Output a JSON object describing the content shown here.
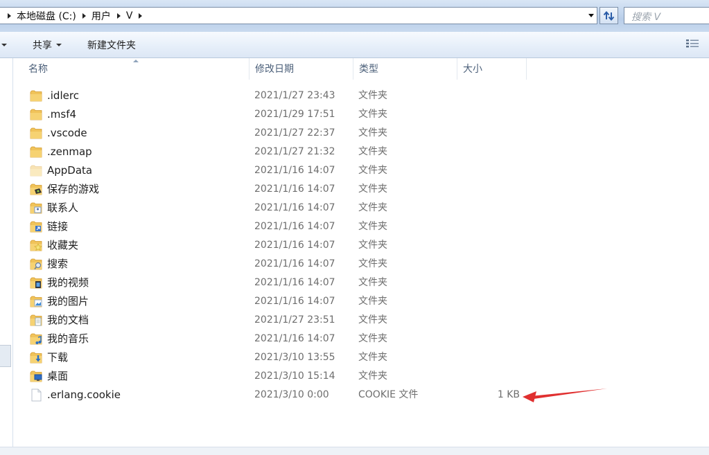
{
  "address": {
    "crumbs": [
      "本地磁盘 (C:)",
      "用户",
      "V"
    ]
  },
  "search": {
    "placeholder": "搜索 V"
  },
  "toolbar": {
    "share_label": "共享",
    "new_folder_label": "新建文件夹"
  },
  "columns": {
    "name": "名称",
    "date": "修改日期",
    "type": "类型",
    "size": "大小"
  },
  "colors": {
    "annotation_arrow": "#e03030",
    "folder": "#e8b44a"
  },
  "files": [
    {
      "name": ".idlerc",
      "date": "2021/1/27 23:43",
      "type": "文件夹",
      "size": "",
      "icon": "folder-icon"
    },
    {
      "name": ".msf4",
      "date": "2021/1/29 17:51",
      "type": "文件夹",
      "size": "",
      "icon": "folder-icon"
    },
    {
      "name": ".vscode",
      "date": "2021/1/27 22:37",
      "type": "文件夹",
      "size": "",
      "icon": "folder-icon"
    },
    {
      "name": ".zenmap",
      "date": "2021/1/27 21:32",
      "type": "文件夹",
      "size": "",
      "icon": "folder-icon"
    },
    {
      "name": "AppData",
      "date": "2021/1/16 14:07",
      "type": "文件夹",
      "size": "",
      "icon": "hidden-folder-icon"
    },
    {
      "name": "保存的游戏",
      "date": "2021/1/16 14:07",
      "type": "文件夹",
      "size": "",
      "icon": "saved-games-folder-icon"
    },
    {
      "name": "联系人",
      "date": "2021/1/16 14:07",
      "type": "文件夹",
      "size": "",
      "icon": "contacts-folder-icon"
    },
    {
      "name": "链接",
      "date": "2021/1/16 14:07",
      "type": "文件夹",
      "size": "",
      "icon": "links-folder-icon"
    },
    {
      "name": "收藏夹",
      "date": "2021/1/16 14:07",
      "type": "文件夹",
      "size": "",
      "icon": "favorites-folder-icon"
    },
    {
      "name": "搜索",
      "date": "2021/1/16 14:07",
      "type": "文件夹",
      "size": "",
      "icon": "searches-folder-icon"
    },
    {
      "name": "我的视频",
      "date": "2021/1/16 14:07",
      "type": "文件夹",
      "size": "",
      "icon": "videos-folder-icon"
    },
    {
      "name": "我的图片",
      "date": "2021/1/16 14:07",
      "type": "文件夹",
      "size": "",
      "icon": "pictures-folder-icon"
    },
    {
      "name": "我的文档",
      "date": "2021/1/27 23:51",
      "type": "文件夹",
      "size": "",
      "icon": "documents-folder-icon"
    },
    {
      "name": "我的音乐",
      "date": "2021/1/16 14:07",
      "type": "文件夹",
      "size": "",
      "icon": "music-folder-icon"
    },
    {
      "name": "下载",
      "date": "2021/3/10 13:55",
      "type": "文件夹",
      "size": "",
      "icon": "downloads-folder-icon"
    },
    {
      "name": "桌面",
      "date": "2021/3/10 15:14",
      "type": "文件夹",
      "size": "",
      "icon": "desktop-folder-icon"
    },
    {
      "name": ".erlang.cookie",
      "date": "2021/3/10 0:00",
      "type": "COOKIE 文件",
      "size": "1 KB",
      "icon": "file-icon"
    }
  ]
}
